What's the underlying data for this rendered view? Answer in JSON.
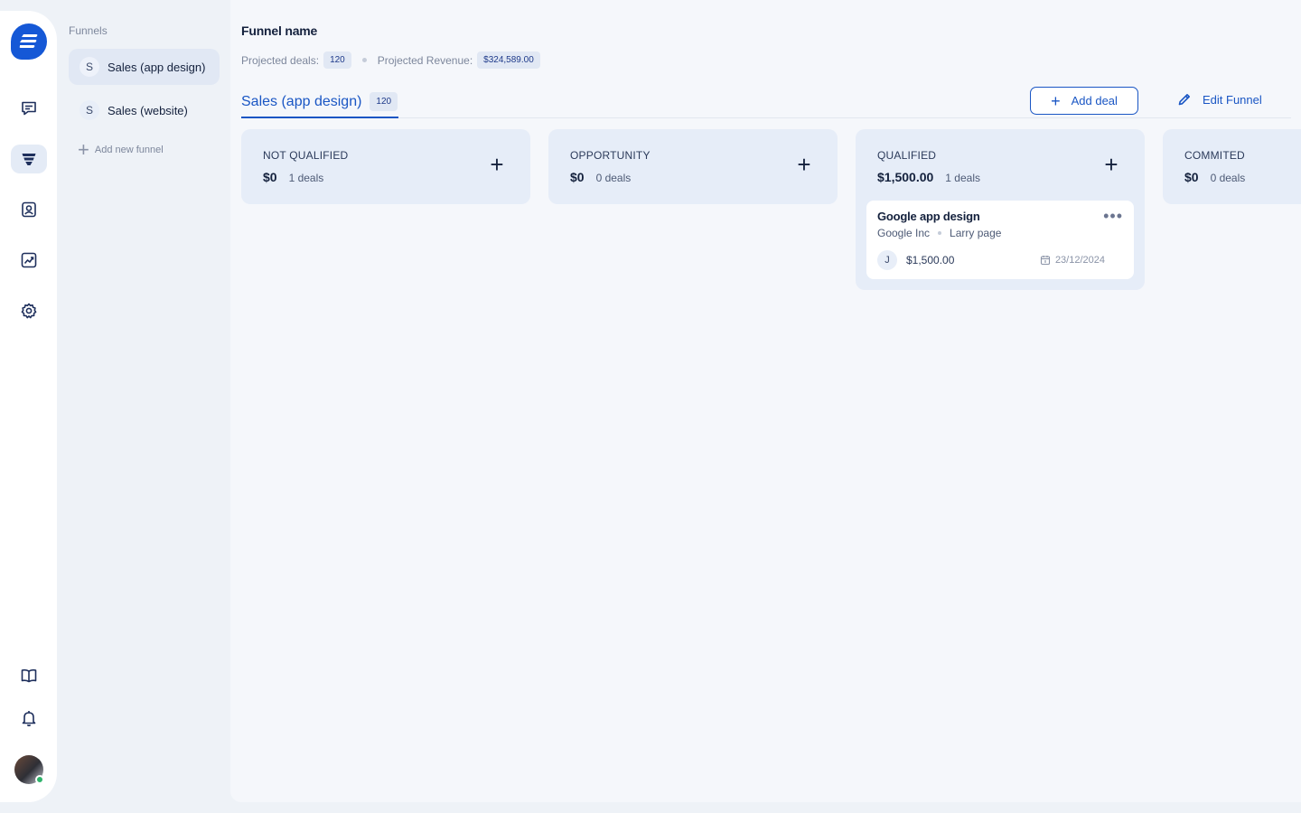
{
  "app": {
    "logo_icon": "brand-logo-icon",
    "accent_color": "#1a56c4"
  },
  "rail": {
    "items": [
      {
        "name": "messages",
        "icon": "chat-icon"
      },
      {
        "name": "funnels",
        "icon": "funnel-icon",
        "active": true
      },
      {
        "name": "contacts",
        "icon": "contact-card-icon"
      },
      {
        "name": "analytics",
        "icon": "chart-icon"
      },
      {
        "name": "settings",
        "icon": "gear-icon"
      }
    ],
    "bottom": [
      {
        "name": "docs",
        "icon": "book-icon"
      },
      {
        "name": "notifications",
        "icon": "bell-icon"
      }
    ]
  },
  "sidebar": {
    "title": "Funnels",
    "items": [
      {
        "initial": "S",
        "label": "Sales (app design)",
        "active": true
      },
      {
        "initial": "S",
        "label": "Sales (website)",
        "active": false
      }
    ],
    "add_label": "Add new funnel"
  },
  "header": {
    "title": "Funnel name",
    "projected_deals_label": "Projected deals:",
    "projected_deals_value": "120",
    "projected_revenue_label": "Projected Revenue:",
    "projected_revenue_value": "$324,589.00"
  },
  "tab": {
    "label": "Sales (app design)",
    "count": "120"
  },
  "actions": {
    "add_deal": "Add deal",
    "edit_funnel": "Edit Funnel"
  },
  "columns": [
    {
      "name": "NOT QUALIFIED",
      "amount": "$0",
      "count": "1 deals"
    },
    {
      "name": "OPPORTUNITY",
      "amount": "$0",
      "count": "0 deals"
    },
    {
      "name": "QUALIFIED",
      "amount": "$1,500.00",
      "count": "1 deals"
    },
    {
      "name": "COMMITED",
      "amount": "$0",
      "count": "0 deals"
    }
  ],
  "deal": {
    "title": "Google app design",
    "company": "Google Inc",
    "contact": "Larry page",
    "owner_initial": "J",
    "value": "$1,500.00",
    "date": "23/12/2024"
  }
}
